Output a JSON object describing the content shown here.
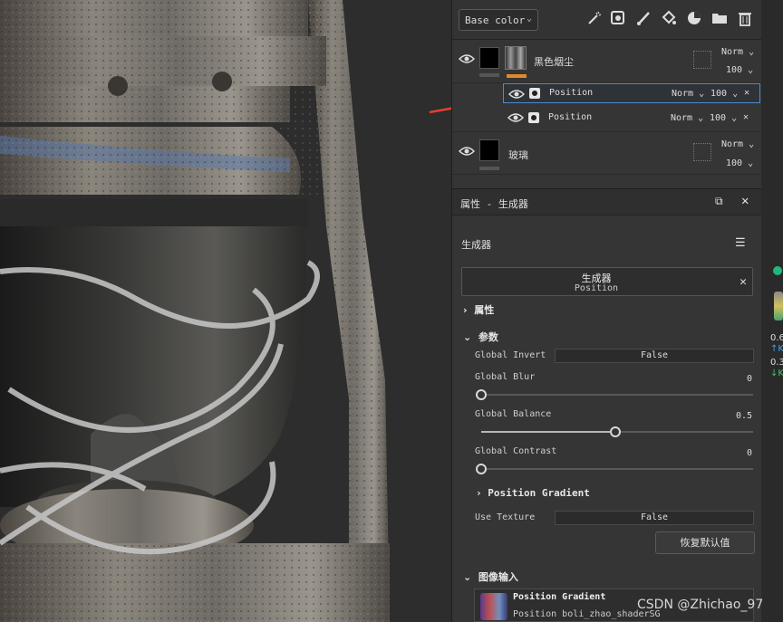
{
  "toolbar": {
    "channel": "Base color",
    "tools": [
      "magic-wand-icon",
      "fill-layer-icon",
      "brush-icon",
      "paint-bucket-icon",
      "color-picker-icon",
      "folder-icon",
      "trash-icon"
    ]
  },
  "layers": [
    {
      "name": "黑色烟尘",
      "blend": "Norm",
      "opacity": "100"
    },
    {
      "name": "玻璃",
      "blend": "Norm",
      "opacity": "100"
    }
  ],
  "effects": [
    {
      "name": "Position",
      "blend": "Norm",
      "opacity": "100"
    },
    {
      "name": "Position",
      "blend": "Norm",
      "opacity": "100"
    }
  ],
  "properties": {
    "title": "属性 - 生成器",
    "section_title": "生成器",
    "generator_name": "生成器",
    "generator_sub": "Position",
    "group_attributes": "属性",
    "group_params": "参数",
    "global_invert_label": "Global Invert",
    "global_invert_value": "False",
    "global_blur_label": "Global Blur",
    "global_blur_value": "0",
    "global_balance_label": "Global Balance",
    "global_balance_value": "0.5",
    "global_contrast_label": "Global Contrast",
    "global_contrast_value": "0",
    "position_gradient_group": "Position Gradient",
    "use_texture_label": "Use Texture",
    "use_texture_value": "False",
    "reset_button": "恢复默认值",
    "image_input_group": "图像输入",
    "image_input_name": "Position Gradient",
    "image_input_source": "Position boli_zhao_shaderSG"
  },
  "right_strip": {
    "v1": "0.6",
    "k1": "K",
    "v2": "0.3",
    "k2": "K"
  },
  "watermark": "CSDN @Zhichao_97",
  "colors": {
    "selection": "#4a8bd4",
    "accent_orange": "#e08a2a",
    "arrow": "#e8402f"
  }
}
